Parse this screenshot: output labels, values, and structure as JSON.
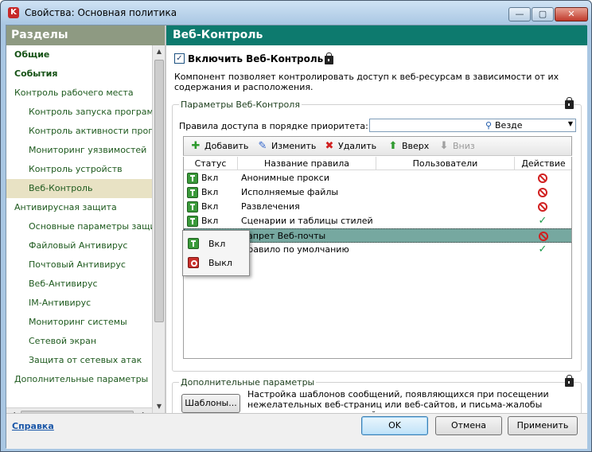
{
  "window": {
    "title": "Свойства: Основная политика",
    "controls": {
      "minimize": "—",
      "maximize": "▢",
      "close": "✕"
    }
  },
  "left_panel": {
    "header": "Разделы",
    "items": [
      {
        "label": "Общие",
        "bold": true,
        "indent": 0
      },
      {
        "label": "События",
        "bold": true,
        "indent": 0
      },
      {
        "label": "Контроль рабочего места",
        "bold": false,
        "indent": 0
      },
      {
        "label": "Контроль запуска программ",
        "bold": false,
        "indent": 1
      },
      {
        "label": "Контроль активности программ",
        "bold": false,
        "indent": 1
      },
      {
        "label": "Мониторинг уязвимостей",
        "bold": false,
        "indent": 1
      },
      {
        "label": "Контроль устройств",
        "bold": false,
        "indent": 1
      },
      {
        "label": "Веб-Контроль",
        "bold": false,
        "indent": 1,
        "selected": true
      },
      {
        "label": "Антивирусная защита",
        "bold": false,
        "indent": 0
      },
      {
        "label": "Основные параметры защиты",
        "bold": false,
        "indent": 1
      },
      {
        "label": "Файловый Антивирус",
        "bold": false,
        "indent": 1
      },
      {
        "label": "Почтовый Антивирус",
        "bold": false,
        "indent": 1
      },
      {
        "label": "Веб-Антивирус",
        "bold": false,
        "indent": 1
      },
      {
        "label": "IM-Антивирус",
        "bold": false,
        "indent": 1
      },
      {
        "label": "Мониторинг системы",
        "bold": false,
        "indent": 1
      },
      {
        "label": "Сетевой экран",
        "bold": false,
        "indent": 1
      },
      {
        "label": "Защита от сетевых атак",
        "bold": false,
        "indent": 1
      },
      {
        "label": "Дополнительные параметры",
        "bold": false,
        "indent": 0
      }
    ]
  },
  "right_panel": {
    "header": "Веб-Контроль",
    "enable_checkbox": {
      "label": "Включить Веб-Контроль",
      "checked": true
    },
    "description": "Компонент позволяет контролировать доступ к веб-ресурсам в зависимости от их содержания и расположения.",
    "params_group": {
      "title": "Параметры Веб-Контроля",
      "rules_label": "Правила доступа в порядке приоритета:",
      "location_dropdown": {
        "value": "Везде"
      },
      "toolbar": {
        "add": "Добавить",
        "edit": "Изменить",
        "delete": "Удалить",
        "up": "Вверх",
        "down": "Вниз"
      },
      "table": {
        "headers": [
          "Статус",
          "Название правила",
          "Пользователи",
          "Действие"
        ],
        "rows": [
          {
            "status": "Вкл",
            "name": "Анонимные прокси",
            "users": "",
            "action": "block"
          },
          {
            "status": "Вкл",
            "name": "Исполняемые файлы",
            "users": "",
            "action": "block"
          },
          {
            "status": "Вкл",
            "name": "Развлечения",
            "users": "",
            "action": "block"
          },
          {
            "status": "Вкл",
            "name": "Сценарии и таблицы стилей",
            "users": "",
            "action": "allow"
          },
          {
            "status": "Выкл",
            "name": "Запрет Веб-почты",
            "users": "",
            "action": "block",
            "selected": true
          },
          {
            "status": "Вкл",
            "name": "Правило по умолчанию",
            "users": "",
            "action": "allow"
          }
        ]
      },
      "status_popup": {
        "items": [
          {
            "label": "Вкл",
            "state": "on"
          },
          {
            "label": "Выкл",
            "state": "off"
          }
        ]
      }
    },
    "extra_group": {
      "title": "Дополнительные параметры",
      "templates_button": "Шаблоны...",
      "templates_description": "Настройка шаблонов сообщений, появляющихся при посещении нежелательных веб-страниц или веб-сайтов, и письма-жалобы администратору локальной сети организации."
    }
  },
  "footer": {
    "help_link": "Справка",
    "ok": "OK",
    "cancel": "Отмена",
    "apply": "Применить"
  }
}
